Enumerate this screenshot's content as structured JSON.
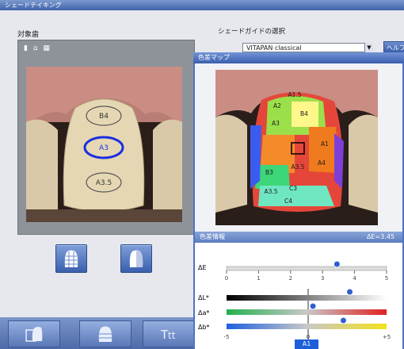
{
  "window": {
    "title": "シェードテイキング"
  },
  "left_panel": {
    "label": "対象歯",
    "mini_icons": "▮ ⌂ ▦",
    "tooth_labels": [
      "B4",
      "A3",
      "A3.5"
    ]
  },
  "shade_guide": {
    "label": "シェードガイドの選択",
    "selected": "VITAPAN classical",
    "button": "ヘルプ"
  },
  "popup": {
    "title": "色差マップ",
    "map_labels": [
      "A1.5",
      "A2",
      "B4",
      "A3",
      "A1",
      "A4",
      "A3.5",
      "B3",
      "C3",
      "C4",
      "A3.5"
    ],
    "panel_title": "色差情報",
    "panel_right": "ΔE=3.45",
    "delta_e_label": "ΔE",
    "delta_e_ticks": [
      "0",
      "1",
      "2",
      "3",
      "4",
      "5"
    ],
    "lab_labels": [
      "ΔL*",
      "Δa*",
      "Δb*"
    ],
    "scale_ends": [
      "-5",
      "0",
      "+5"
    ],
    "selected_shade": "A1"
  },
  "values": {
    "delta_e": 3.45,
    "delta_l": 2.6,
    "delta_a": 0.3,
    "delta_b": 2.2
  },
  "colors": {
    "accent": "#3a5fae",
    "marker": "#2f5fd0",
    "highlight_ring": "#1a2fe0"
  }
}
